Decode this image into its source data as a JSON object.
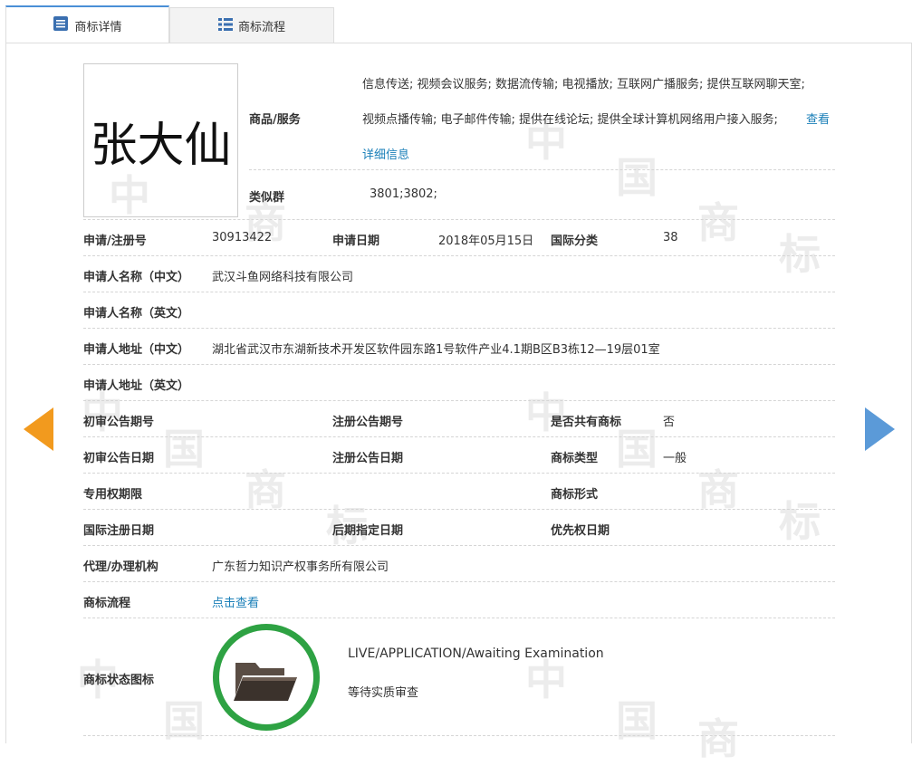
{
  "tabs": [
    {
      "label": "商标详情",
      "icon": "document-list-icon",
      "active": true
    },
    {
      "label": "商标流程",
      "icon": "grid-list-icon",
      "active": false
    }
  ],
  "trademark": {
    "image_text": "张大仙",
    "goods_services_label": "商品/服务",
    "goods_services_line1": "信息传送; 视频会议服务; 数据流传输; 电视播放; 互联网广播服务; 提供互联网聊天室;",
    "goods_services_line2": "视频点播传输; 电子邮件传输; 提供在线论坛; 提供全球计算机网络用户接入服务;",
    "view_detail_a": "查看",
    "view_detail_b": "详细信息",
    "similar_group_label": "类似群",
    "similar_group_value": "3801;3802;"
  },
  "fields": {
    "reg_no_label": "申请/注册号",
    "reg_no_value": "30913422",
    "apply_date_label": "申请日期",
    "apply_date_value": "2018年05月15日",
    "intl_class_label": "国际分类",
    "intl_class_value": "38",
    "applicant_cn_label": "申请人名称（中文）",
    "applicant_cn_value": "武汉斗鱼网络科技有限公司",
    "applicant_en_label": "申请人名称（英文）",
    "address_cn_label": "申请人地址（中文）",
    "address_cn_value": "湖北省武汉市东湖新技术开发区软件园东路1号软件产业4.1期B区B3栋12—19层01室",
    "address_en_label": "申请人地址（英文）",
    "prelim_issue_label": "初审公告期号",
    "reg_issue_label": "注册公告期号",
    "shared_label": "是否共有商标",
    "shared_value": "否",
    "prelim_date_label": "初审公告日期",
    "reg_date_label": "注册公告日期",
    "tm_type_label": "商标类型",
    "tm_type_value": "一般",
    "exclusive_period_label": "专用权期限",
    "tm_form_label": "商标形式",
    "intl_reg_date_label": "国际注册日期",
    "later_design_date_label": "后期指定日期",
    "priority_date_label": "优先权日期",
    "agent_label": "代理/办理机构",
    "agent_value": "广东哲力知识产权事务所有限公司",
    "process_label": "商标流程",
    "process_link": "点击查看",
    "status_icon_label": "商标状态图标",
    "status_en": "LIVE/APPLICATION/Awaiting Examination",
    "status_cn": "等待实质审查"
  },
  "watermark": [
    "中",
    "国",
    "商",
    "标"
  ],
  "colors": {
    "accent": "#4a8fd6",
    "link": "#1a7fb8",
    "status_green": "#2ea243",
    "prev_arrow": "#f29a1e",
    "next_arrow": "#5b9ad8"
  }
}
